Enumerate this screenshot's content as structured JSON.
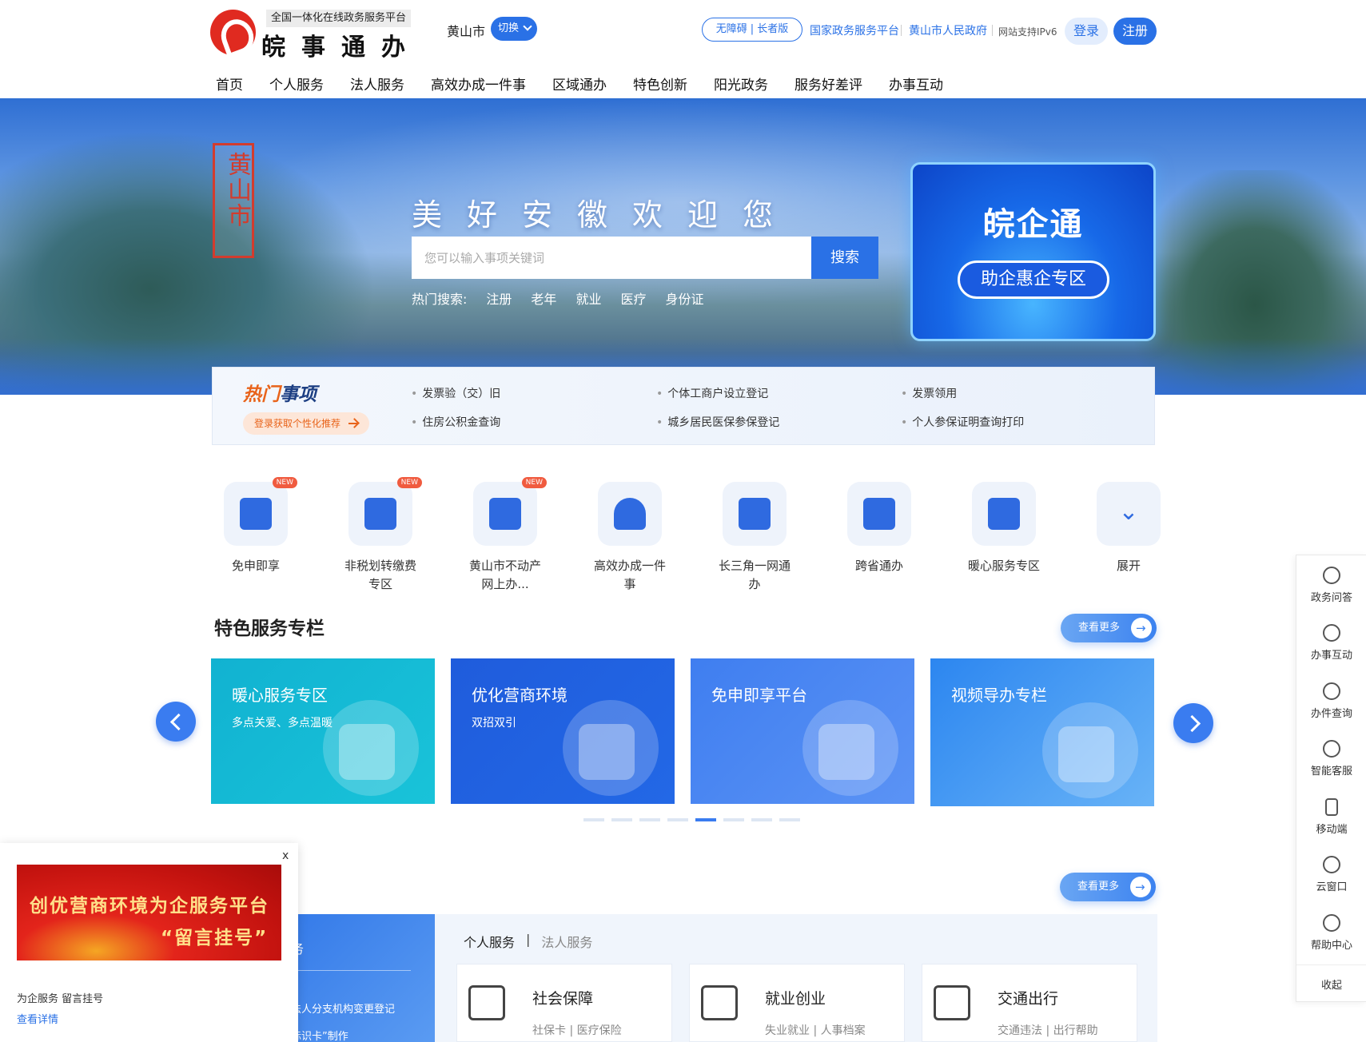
{
  "header": {
    "logo_sub": "全国一体化在线政务服务平台",
    "logo_main": "皖事通办",
    "city": "黄山市",
    "switch_label": "切换",
    "accessibility": "无障碍",
    "elder": "长者版",
    "links": [
      "国家政务服务平台",
      "黄山市人民政府"
    ],
    "ipv6": "网站支持IPv6",
    "login": "登录",
    "register": "注册"
  },
  "nav": [
    "首页",
    "个人服务",
    "法人服务",
    "高效办成一件事",
    "区域通办",
    "特色创新",
    "阳光政务",
    "服务好差评",
    "办事互动"
  ],
  "banner": {
    "seal": "黄山市",
    "welcome": "美好安徽欢迎您",
    "search_placeholder": "您可以输入事项关键词",
    "search_button": "搜索",
    "hot_label": "热门搜索:",
    "hot_keywords": [
      "注册",
      "老年",
      "就业",
      "医疗",
      "身份证"
    ],
    "promo_title": "皖企通",
    "promo_button": "助企惠企专区"
  },
  "hot_items": {
    "title_a": "热门",
    "title_b": "事项",
    "recommend": "登录获取个性化推荐",
    "links": [
      "发票验（交）旧",
      "个体工商户设立登记",
      "发票领用",
      "住房公积金查询",
      "城乡居民医保参保登记",
      "个人参保证明查询打印"
    ]
  },
  "quick_items": [
    {
      "label": "免申即享",
      "badge": "NEW"
    },
    {
      "label": "非税划转缴费专区",
      "badge": "NEW"
    },
    {
      "label": "黄山市不动产网上办...",
      "badge": "NEW"
    },
    {
      "label": "高效办成一件事",
      "badge": ""
    },
    {
      "label": "长三角一网通办",
      "badge": ""
    },
    {
      "label": "跨省通办",
      "badge": ""
    },
    {
      "label": "暖心服务专区",
      "badge": ""
    },
    {
      "label": "展开",
      "badge": ""
    }
  ],
  "feature": {
    "title": "特色服务专栏",
    "more": "查看更多",
    "cards": [
      {
        "title": "暖心服务专区",
        "sub": "多点关爱、多点温暖"
      },
      {
        "title": "优化营商环境",
        "sub": "双招双引"
      },
      {
        "title": "免申即享平台",
        "sub": ""
      },
      {
        "title": "视频导办专栏",
        "sub": ""
      }
    ],
    "active_dot": 5,
    "dot_count": 8
  },
  "bottom": {
    "more": "查看更多",
    "left_lines": [
      "务",
      "法人分支机构变更登记",
      "标识卡”制作"
    ],
    "tab_active": "个人服务",
    "tab_inactive": "法人服务",
    "services": [
      {
        "title": "社会保障",
        "sub": "社保卡 | 医疗保险"
      },
      {
        "title": "就业创业",
        "sub": "失业就业 | 人事档案"
      },
      {
        "title": "交通出行",
        "sub": "交通违法 | 出行帮助"
      }
    ]
  },
  "sidebar": {
    "items": [
      "政务问答",
      "办事互动",
      "办件查询",
      "智能客服",
      "移动端",
      "云窗口",
      "帮助中心"
    ],
    "collapse": "收起"
  },
  "popup": {
    "close": "x",
    "line1": "创优营商环境为企服务平台",
    "line2": "“留言挂号”",
    "caption": "为企服务 留言挂号",
    "detail": "查看详情"
  }
}
